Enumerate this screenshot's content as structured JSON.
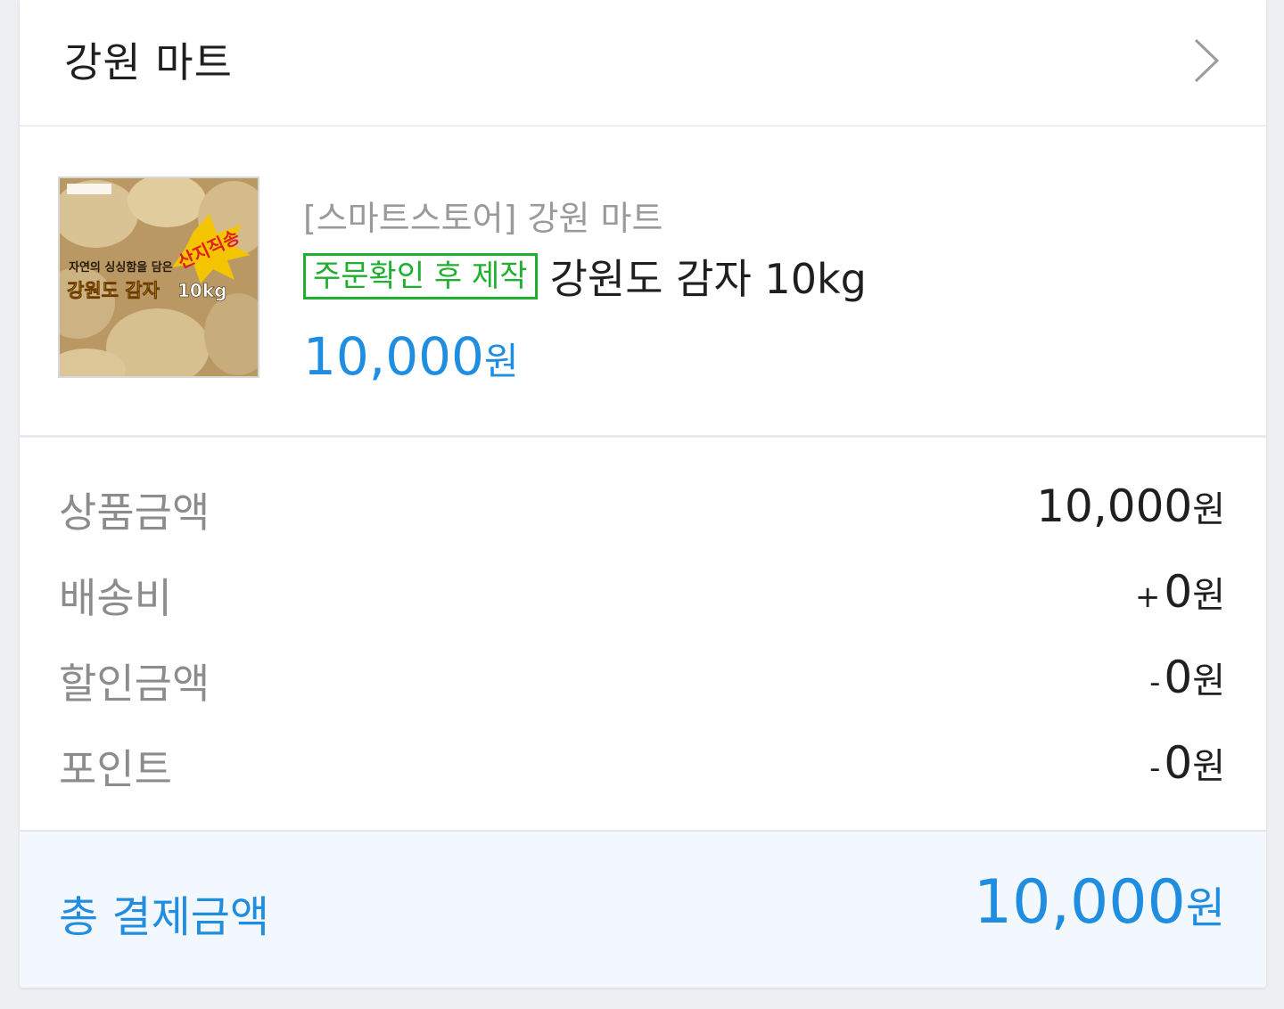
{
  "store": {
    "name": "강원 마트",
    "chevron_icon": "chevron-right-icon"
  },
  "product": {
    "seller": "[스마트스토어] 강원 마트",
    "badge": "주문확인 후 제작",
    "title": "강원도 감자 10kg",
    "price_number": "10,000",
    "price_unit": "원",
    "thumbnail": {
      "tag": "산지직송",
      "caption": "자연의 싱싱함을 담은",
      "headline": "강원도 감자",
      "weight": "10kg"
    }
  },
  "summary": [
    {
      "label": "상품금액",
      "sign": "",
      "amount": "10,000",
      "unit": "원"
    },
    {
      "label": "배송비",
      "sign": "+",
      "amount": "0",
      "unit": "원"
    },
    {
      "label": "할인금액",
      "sign": "-",
      "amount": "0",
      "unit": "원"
    },
    {
      "label": "포인트",
      "sign": "-",
      "amount": "0",
      "unit": "원"
    }
  ],
  "total": {
    "label": "총 결제금액",
    "amount": "10,000",
    "unit": "원"
  },
  "colors": {
    "accent": "#1f8de0",
    "badge": "#1fb02f"
  }
}
